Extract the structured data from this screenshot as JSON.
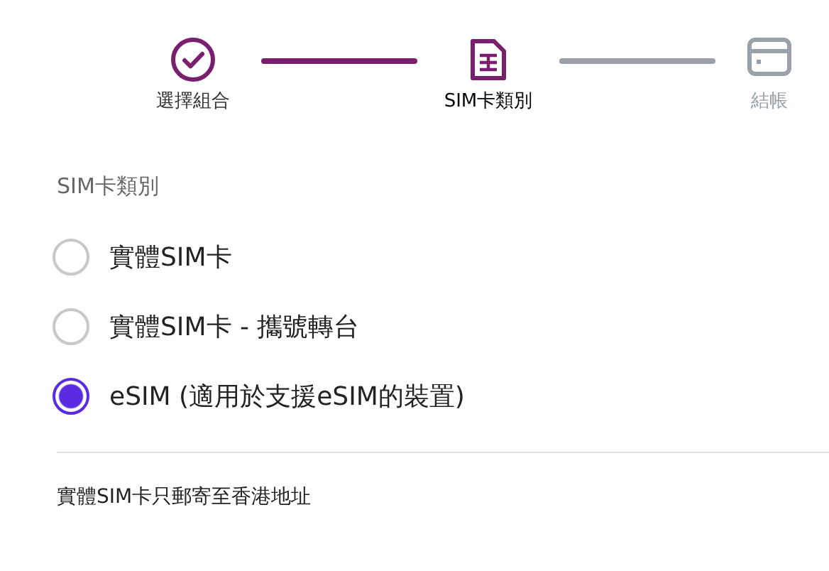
{
  "steps": [
    {
      "label": "選擇組合",
      "kind": "check",
      "selected": false
    },
    {
      "label": "SIM卡類別",
      "kind": "sim",
      "selected": true
    },
    {
      "label": "結帳",
      "kind": "card",
      "selected": false
    }
  ],
  "section_title": "SIM卡類別",
  "options": [
    {
      "label": "實體SIM卡",
      "selected": false
    },
    {
      "label": "實體SIM卡 - 攜號轉台",
      "selected": false
    },
    {
      "label": "eSIM (適用於支援eSIM的裝置)",
      "selected": true
    }
  ],
  "note": "實體SIM卡只郵寄至香港地址"
}
